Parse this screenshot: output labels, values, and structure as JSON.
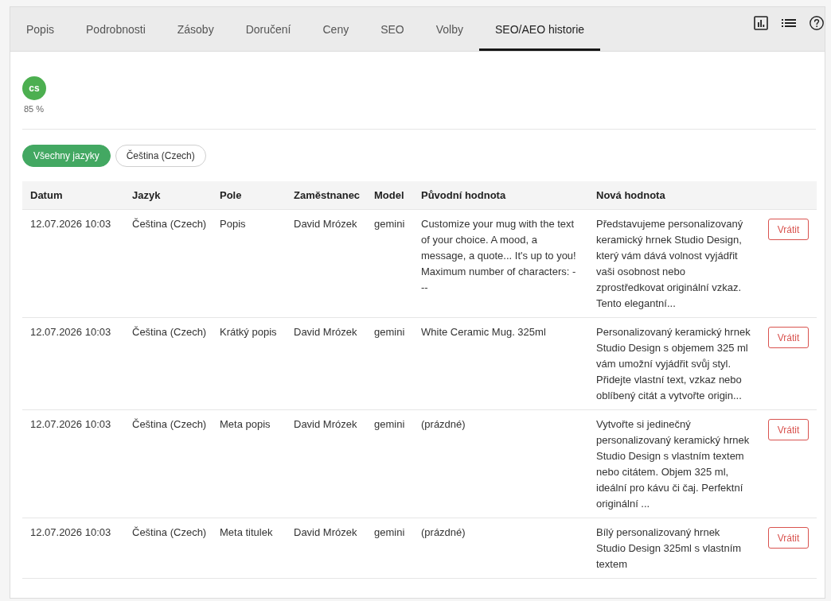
{
  "tabs": [
    {
      "label": "Popis",
      "selected": false
    },
    {
      "label": "Podrobnosti",
      "selected": false
    },
    {
      "label": "Zásoby",
      "selected": false
    },
    {
      "label": "Doručení",
      "selected": false
    },
    {
      "label": "Ceny",
      "selected": false
    },
    {
      "label": "SEO",
      "selected": false
    },
    {
      "label": "Volby",
      "selected": false
    },
    {
      "label": "SEO/AEO historie",
      "selected": true
    }
  ],
  "languages": [
    {
      "code": "cs",
      "percentage": "85 %"
    }
  ],
  "filters": [
    {
      "label": "Všechny jazyky",
      "selected": true
    },
    {
      "label": "Čeština (Czech)",
      "selected": false
    }
  ],
  "table": {
    "columns": [
      "Datum",
      "Jazyk",
      "Pole",
      "Zaměstnanec",
      "Model",
      "Původní hodnota",
      "Nová hodnota"
    ],
    "rows": [
      {
        "cells": [
          "12.07.2026 10:03",
          "Čeština (Czech)",
          "Popis",
          "David Mrózek",
          "gemini",
          "Customize your mug with the text of your choice. A mood, a message, a quote... It's up to you! Maximum number of characters: ---",
          "Představujeme personalizovaný keramický hrnek Studio Design, který vám dává volnost vyjádřit vaši osobnost nebo zprostředkovat originální vzkaz. Tento elegantní..."
        ],
        "action": "Vrátit"
      },
      {
        "cells": [
          "12.07.2026 10:03",
          "Čeština (Czech)",
          "Krátký popis",
          "David Mrózek",
          "gemini",
          "White Ceramic Mug. 325ml",
          "Personalizovaný keramický hrnek Studio Design s objemem 325 ml vám umožní vyjádřit svůj styl. Přidejte vlastní text, vzkaz nebo oblíbený citát a vytvořte origin..."
        ],
        "action": "Vrátit"
      },
      {
        "cells": [
          "12.07.2026 10:03",
          "Čeština (Czech)",
          "Meta popis",
          "David Mrózek",
          "gemini",
          "(prázdné)",
          "Vytvořte si jedinečný personalizovaný keramický hrnek Studio Design s vlastním textem nebo citátem. Objem 325 ml, ideální pro kávu či čaj. Perfektní originální ..."
        ],
        "action": "Vrátit"
      },
      {
        "cells": [
          "12.07.2026 10:03",
          "Čeština (Czech)",
          "Meta titulek",
          "David Mrózek",
          "gemini",
          "(prázdné)",
          "Bílý personalizovaný hrnek Studio Design 325ml s vlastním textem"
        ],
        "action": "Vrátit"
      }
    ]
  }
}
